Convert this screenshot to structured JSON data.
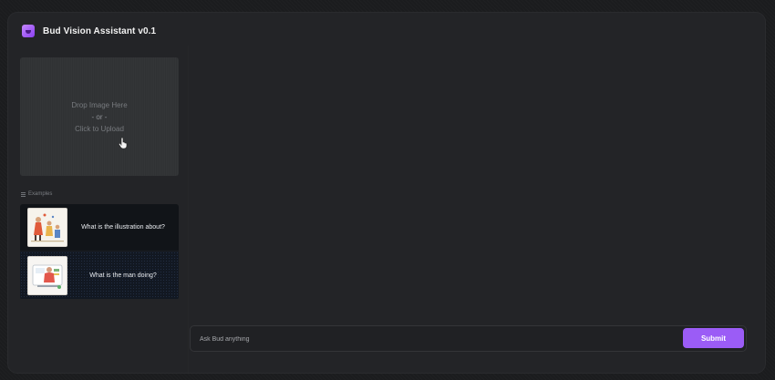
{
  "app": {
    "title": "Bud Vision Assistant v0.1"
  },
  "upload": {
    "line1": "Drop Image Here",
    "line2": "- or -",
    "line3": "Click to Upload"
  },
  "examples": {
    "label": "Examples",
    "items": [
      {
        "text": "What is the illustration about?",
        "thumb_icon": "illustration-thumbnail"
      },
      {
        "text": "What is the man doing?",
        "thumb_icon": "man-working-thumbnail"
      }
    ]
  },
  "input": {
    "placeholder": "Ask Bud anything",
    "value": ""
  },
  "submit": {
    "label": "Submit"
  },
  "colors": {
    "accent": "#9b5cf6",
    "background": "#232427"
  }
}
